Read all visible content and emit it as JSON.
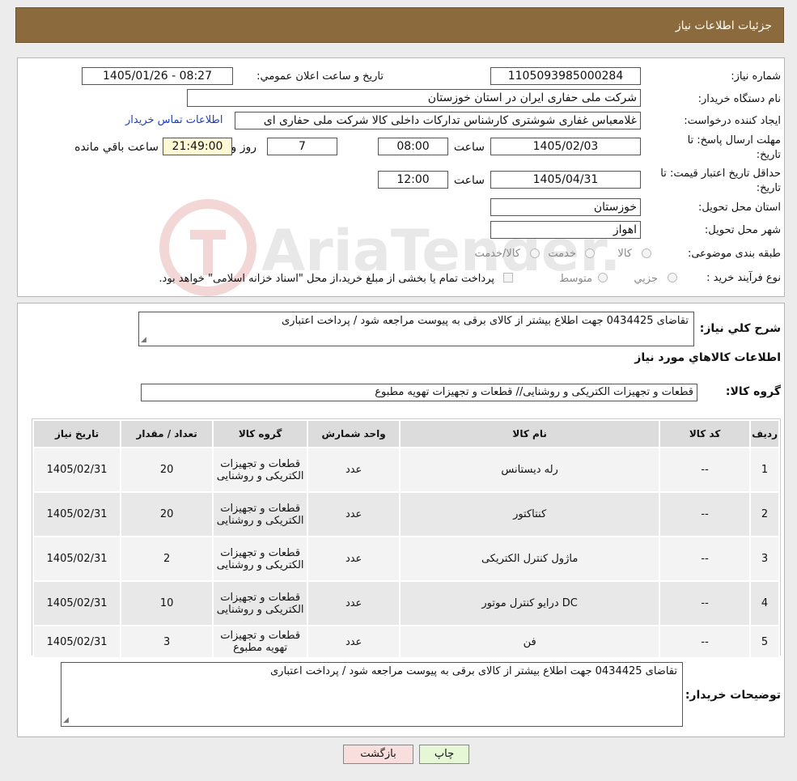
{
  "header": {
    "title": "جزئیات اطلاعات نیاز"
  },
  "form": {
    "need_number_label": "شماره نیاز:",
    "need_number": "1105093985000284",
    "announce_label": "تاریخ و ساعت اعلان عمومي:",
    "announce_value": "1405/01/26 - 08:27",
    "buyer_org_label": "نام دستگاه خریدار:",
    "buyer_org": "شرکت ملی حفاری ایران در استان خوزستان",
    "creator_label": "ایجاد کننده درخواست:",
    "creator": "غلامعباس غفاری شوشتری کارشناس تدارکات داخلی کالا شرکت ملی حفاری ای",
    "contact_link": "اطلاعات تماس خریدار",
    "reply_deadline_label_1": "مهلت ارسال پاسخ: تا",
    "reply_deadline_label_2": "تاریخ:",
    "reply_date": "1405/02/03",
    "time_label": "ساعت",
    "reply_time": "08:00",
    "days_value": "7",
    "days_label": "روز و",
    "remaining_time": "21:49:00",
    "remaining_label": "ساعت باقي مانده",
    "price_valid_label_1": "حداقل تاریخ اعتبار قیمت: تا",
    "price_valid_label_2": "تاریخ:",
    "price_valid_date": "1405/04/31",
    "price_valid_time": "12:00",
    "province_label": "استان محل تحویل:",
    "province": "خوزستان",
    "city_label": "شهر محل تحویل:",
    "city": "اهواز",
    "category_label": "طبقه بندی موضوعی:",
    "category_options": [
      "کالا",
      "خدمت",
      "کالا/خدمت"
    ],
    "process_label": "نوع فرآیند خرید :",
    "process_options": [
      "جزيي",
      "متوسط"
    ],
    "payment_note": "پرداخت تمام یا بخشی از مبلغ خرید،از محل \"اسناد خزانه اسلامی\" خواهد بود."
  },
  "summary": {
    "description_label": "شرح کلي نياز:",
    "description": "تقاضای  0434425 جهت اطلاع بیشتر از کالای  برقی به پیوست مراجعه شود / پرداخت اعتباری",
    "goods_info_title": "اطلاعات کالاهاي مورد نياز",
    "goods_group_label": "گروه کالا:",
    "goods_group": "قطعات و تجهیزات الکتریکی و روشنایی//  قطعات و تجهیزات تهویه مطبوع"
  },
  "table": {
    "headers": [
      "رديف",
      "کد کالا",
      "نام کالا",
      "واحد شمارش",
      "گروه کالا",
      "تعداد / مقدار",
      "تاریخ نیاز"
    ],
    "rows": [
      {
        "row": "1",
        "code": "--",
        "name": "رله دیستانس",
        "unit": "عدد",
        "group": "قطعات و تجهیزات الکتریکی و روشنایی",
        "qty": "20",
        "date": "1405/02/31"
      },
      {
        "row": "2",
        "code": "--",
        "name": "کنتاکتور",
        "unit": "عدد",
        "group": "قطعات و تجهیزات الکتریکی و روشنایی",
        "qty": "20",
        "date": "1405/02/31"
      },
      {
        "row": "3",
        "code": "--",
        "name": "ماژول کنترل الکتریکی",
        "unit": "عدد",
        "group": "قطعات و تجهیزات الکتریکی و روشنایی",
        "qty": "2",
        "date": "1405/02/31"
      },
      {
        "row": "4",
        "code": "--",
        "name": "DC درایو کنترل موتور",
        "unit": "عدد",
        "group": "قطعات و تجهیزات الکتریکی و روشنایی",
        "qty": "10",
        "date": "1405/02/31"
      },
      {
        "row": "5",
        "code": "--",
        "name": "فن",
        "unit": "عدد",
        "group": "قطعات و تجهیزات تهویه مطبوع",
        "qty": "3",
        "date": "1405/02/31"
      }
    ]
  },
  "buyer_notes": {
    "label": "توضیحات خریدار:",
    "text": "تقاضای  0434425 جهت اطلاع بیشتر از کالای  برقی به پیوست مراجعه شود / پرداخت اعتباری"
  },
  "buttons": {
    "print": "چاپ",
    "back": "بازگشت"
  },
  "watermark": {
    "text": "AriaTender.neT"
  },
  "colors": {
    "header": "#8b6b3e",
    "link": "#1a3fc0",
    "back_button": "#f9dede",
    "print_button": "#e6f7d6",
    "remaining_box": "#fff9d4"
  }
}
